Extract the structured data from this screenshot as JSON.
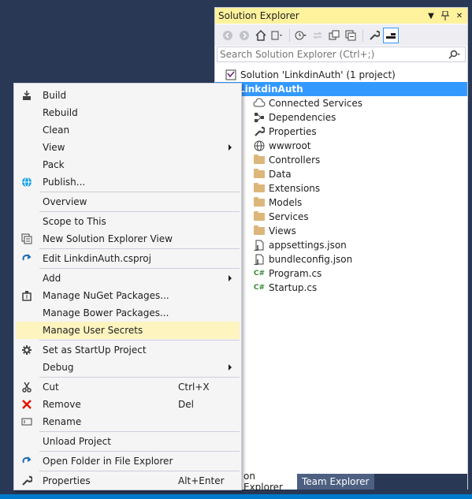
{
  "solution_explorer": {
    "title": "Solution Explorer",
    "search_placeholder": "Search Solution Explorer (Ctrl+;)",
    "tree": [
      {
        "label": "Solution 'LinkdinAuth' (1 project)",
        "icon": "solution-icon"
      },
      {
        "label": "LinkdinAuth",
        "icon": "web-project-icon",
        "selected": true
      },
      {
        "label": "Connected Services",
        "icon": "cloud-icon"
      },
      {
        "label": "Dependencies",
        "icon": "dependencies-icon"
      },
      {
        "label": "Properties",
        "icon": "wrench-icon"
      },
      {
        "label": "wwwroot",
        "icon": "globe-icon"
      },
      {
        "label": "Controllers",
        "icon": "folder-icon"
      },
      {
        "label": "Data",
        "icon": "folder-icon"
      },
      {
        "label": "Extensions",
        "icon": "folder-icon"
      },
      {
        "label": "Models",
        "icon": "folder-icon"
      },
      {
        "label": "Services",
        "icon": "folder-icon"
      },
      {
        "label": "Views",
        "icon": "folder-icon"
      },
      {
        "label": "appsettings.json",
        "icon": "json-file-icon"
      },
      {
        "label": "bundleconfig.json",
        "icon": "json-file-icon"
      },
      {
        "label": "Program.cs",
        "icon": "csharp-file-icon"
      },
      {
        "label": "Startup.cs",
        "icon": "csharp-file-icon"
      }
    ],
    "tabs": [
      {
        "label": "Solution Explorer",
        "visible_text": "on Explorer",
        "active": true
      },
      {
        "label": "Team Explorer",
        "active": false
      }
    ]
  },
  "context_menu": {
    "items": [
      {
        "label": "Build",
        "icon": "build-icon"
      },
      {
        "label": "Rebuild"
      },
      {
        "label": "Clean"
      },
      {
        "label": "View",
        "submenu": true
      },
      {
        "label": "Pack"
      },
      {
        "label": "Publish...",
        "icon": "globe-icon"
      },
      {
        "label": "Overview"
      },
      {
        "label": "Scope to This"
      },
      {
        "label": "New Solution Explorer View",
        "icon": "new-view-icon"
      },
      {
        "label": "Edit LinkdinAuth.csproj",
        "icon": "refresh-arrow-icon"
      },
      {
        "label": "Add",
        "submenu": true
      },
      {
        "label": "Manage NuGet Packages...",
        "icon": "nuget-icon"
      },
      {
        "label": "Manage Bower Packages..."
      },
      {
        "label": "Manage User Secrets",
        "highlighted": true
      },
      {
        "label": "Set as StartUp Project",
        "icon": "gear-icon"
      },
      {
        "label": "Debug",
        "submenu": true
      },
      {
        "label": "Cut",
        "icon": "scissors-icon",
        "shortcut": "Ctrl+X"
      },
      {
        "label": "Remove",
        "icon": "remove-x-icon",
        "shortcut": "Del"
      },
      {
        "label": "Rename",
        "icon": "rename-icon"
      },
      {
        "label": "Unload Project"
      },
      {
        "label": "Open Folder in File Explorer",
        "icon": "refresh-arrow-icon"
      },
      {
        "label": "Properties",
        "icon": "wrench-icon",
        "shortcut": "Alt+Enter"
      }
    ]
  },
  "colors": {
    "background": "#293955",
    "title_bar": "#fff29d",
    "selection": "#3399ff",
    "menu_highlight": "#fdf4bf",
    "accent": "#007acc"
  }
}
